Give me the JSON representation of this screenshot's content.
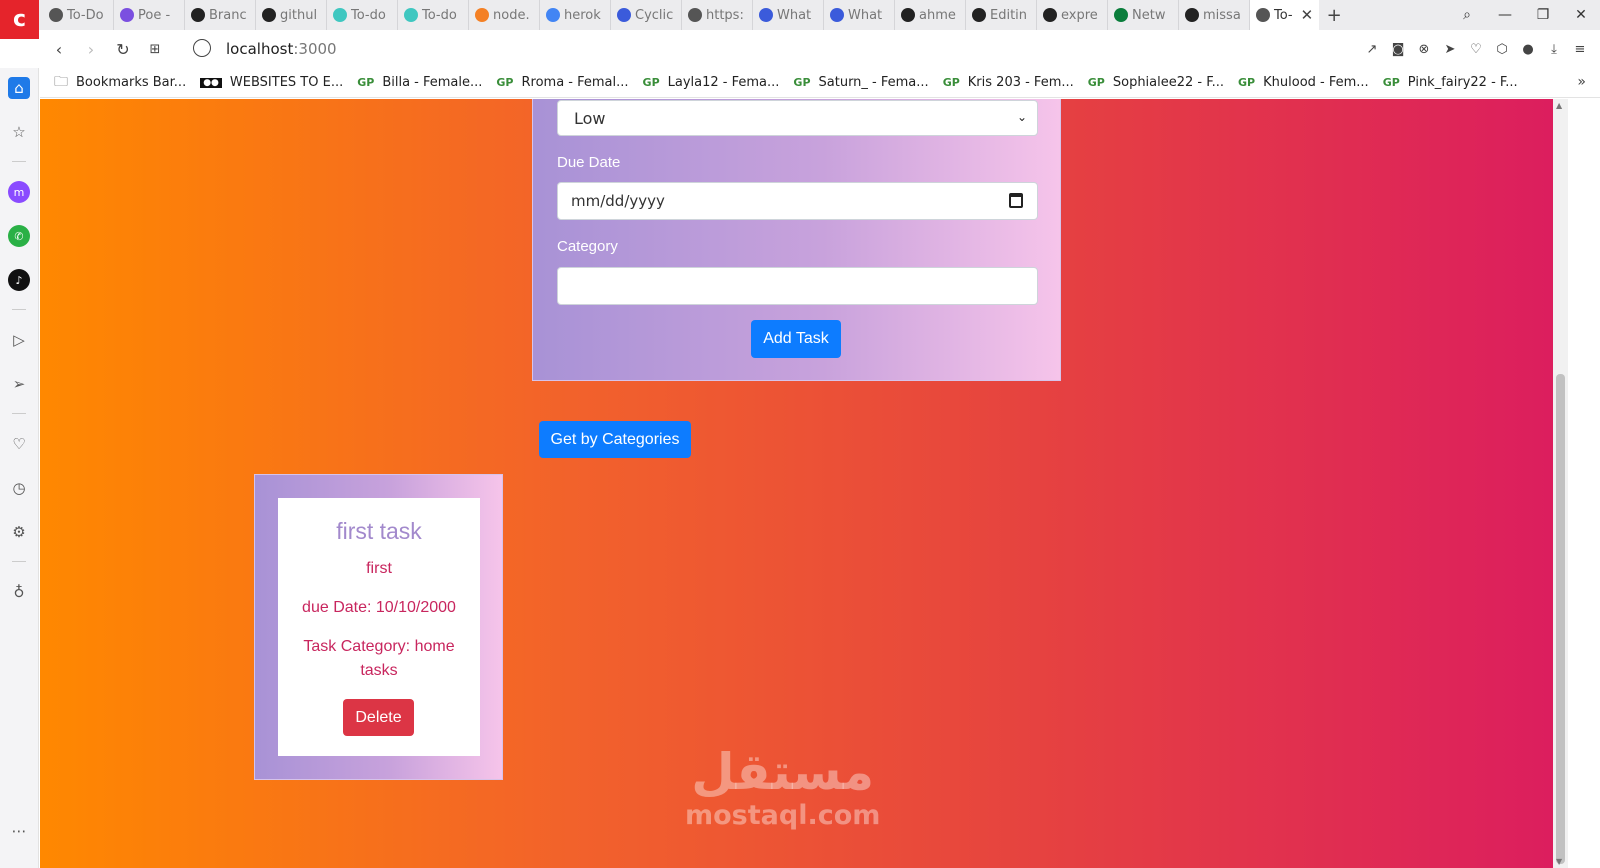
{
  "browser": {
    "tabs": [
      {
        "label": "To-Do",
        "color": "#555"
      },
      {
        "label": "Poe -",
        "color": "#7b4fe0"
      },
      {
        "label": "Branc",
        "color": "#222"
      },
      {
        "label": "githul",
        "color": "#222"
      },
      {
        "label": "To-do",
        "color": "#3fc7c0"
      },
      {
        "label": "To-do",
        "color": "#3fc7c0"
      },
      {
        "label": "node.",
        "color": "#f48024"
      },
      {
        "label": "herok",
        "color": "#4285f4"
      },
      {
        "label": "Cyclic",
        "color": "#3b5bdb"
      },
      {
        "label": "https:",
        "color": "#555"
      },
      {
        "label": "What",
        "color": "#3b5bdb"
      },
      {
        "label": "What",
        "color": "#3b5bdb"
      },
      {
        "label": "ahme",
        "color": "#222"
      },
      {
        "label": "Editin",
        "color": "#222"
      },
      {
        "label": "expre",
        "color": "#222"
      },
      {
        "label": "Netw",
        "color": "#0a7d3b"
      },
      {
        "label": "missa",
        "color": "#222"
      }
    ],
    "active_tab": "To-",
    "url_host": "localhost",
    "url_port": ":3000",
    "bookmarks": [
      {
        "label": "Bookmarks Bar...",
        "icon": "folder-icon"
      },
      {
        "label": "WEBSITES TO E...",
        "icon": "medium-icon"
      },
      {
        "label": "Billa - Female...",
        "icon": "gp-icon"
      },
      {
        "label": "Rroma - Femal...",
        "icon": "gp-icon"
      },
      {
        "label": "Layla12 - Fema...",
        "icon": "gp-icon"
      },
      {
        "label": "Saturn_ - Fema...",
        "icon": "gp-icon"
      },
      {
        "label": "Kris 203 - Fem...",
        "icon": "gp-icon"
      },
      {
        "label": "Sophialee22 - F...",
        "icon": "gp-icon"
      },
      {
        "label": "Khulood - Fem...",
        "icon": "gp-icon"
      },
      {
        "label": "Pink_fairy22 - F...",
        "icon": "gp-icon"
      }
    ]
  },
  "form": {
    "priority_value": "Low",
    "due_date_label": "Due Date",
    "due_date_placeholder": "mm/dd/yyyy",
    "category_label": "Category",
    "category_value": "",
    "add_task_label": "Add Task"
  },
  "get_by_categories_label": "Get by Categories",
  "task": {
    "title": "first task",
    "description": "first",
    "due": "due Date: 10/10/2000",
    "category_line1": "Task Category: home",
    "category_line2": "tasks",
    "delete_label": "Delete"
  },
  "watermark": {
    "arabic": "مستقل",
    "latin": "mostaql.com"
  },
  "colors": {
    "accent": "#0d7cff",
    "danger": "#dc3545",
    "task_text": "#c8265e",
    "task_title": "#a289cc"
  }
}
